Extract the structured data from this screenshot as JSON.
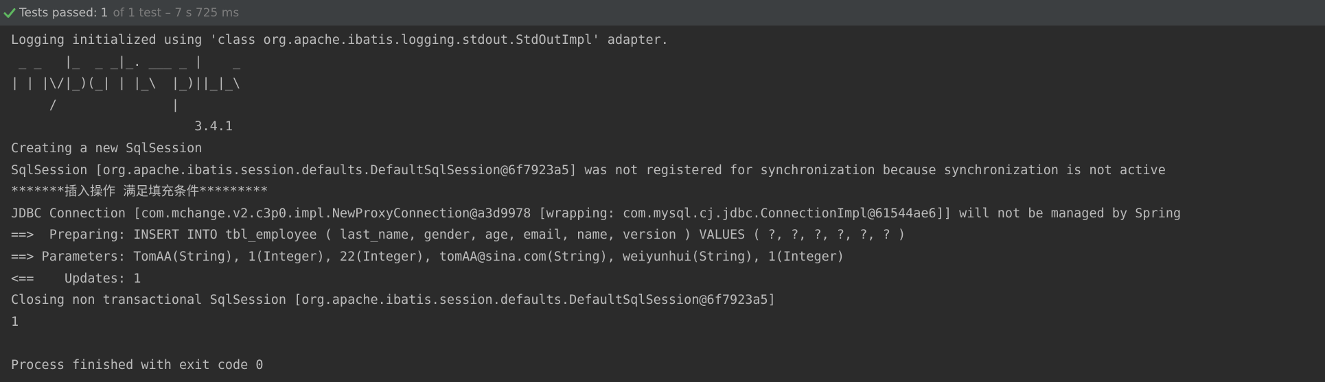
{
  "status": {
    "label": "Tests passed:",
    "count": "1",
    "detail": "of 1 test – 7 s 725 ms",
    "icon": "check-icon",
    "icon_color": "#5fb760"
  },
  "console": {
    "lines": [
      "Logging initialized using 'class org.apache.ibatis.logging.stdout.StdOutImpl' adapter.",
      " _ _   |_  _ _|_. ___ _ |    _ ",
      "| | |\\/|_)(_| | |_\\  |_)||_|_\\ ",
      "     /               |         ",
      "                        3.4.1 ",
      "Creating a new SqlSession",
      "SqlSession [org.apache.ibatis.session.defaults.DefaultSqlSession@6f7923a5] was not registered for synchronization because synchronization is not active",
      "*******插入操作 满足填充条件*********",
      "JDBC Connection [com.mchange.v2.c3p0.impl.NewProxyConnection@a3d9978 [wrapping: com.mysql.cj.jdbc.ConnectionImpl@61544ae6]] will not be managed by Spring",
      "==>  Preparing: INSERT INTO tbl_employee ( last_name, gender, age, email, name, version ) VALUES ( ?, ?, ?, ?, ?, ? )",
      "==> Parameters: TomAA(String), 1(Integer), 22(Integer), tomAA@sina.com(String), weiyunhui(String), 1(Integer)",
      "<==    Updates: 1",
      "Closing non transactional SqlSession [org.apache.ibatis.session.defaults.DefaultSqlSession@6f7923a5]",
      "1",
      "",
      "Process finished with exit code 0"
    ]
  }
}
